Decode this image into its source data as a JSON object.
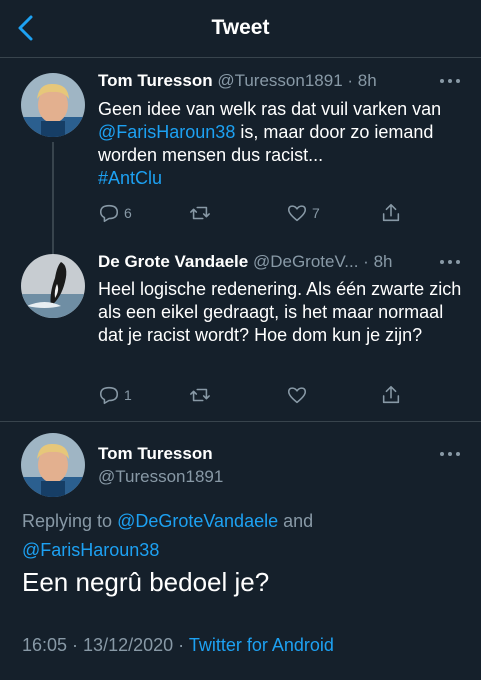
{
  "header": {
    "title": "Tweet"
  },
  "tweets": [
    {
      "name": "Tom Turesson",
      "handle": "@Turesson1891",
      "dot": "·",
      "time": "8h",
      "text_before": "Geen idee van welk ras dat vuil varken van ",
      "mention": "@FarisHaroun38",
      "text_after": " is, maar door zo iemand worden mensen dus racist...",
      "hashtag": "#AntClu",
      "reply_count": "6",
      "retweet_count": "",
      "like_count": "7"
    },
    {
      "name": "De Grote Vandaele",
      "handle": "@DeGroteV...",
      "dot": "·",
      "time": "8h",
      "text": "Heel logische redenering. Als één zwarte zich als een eikel gedraagt, is het maar normaal dat je racist wordt? Hoe dom kun je zijn?",
      "reply_count": "1",
      "retweet_count": "",
      "like_count": ""
    }
  ],
  "focused": {
    "name": "Tom Turesson",
    "handle": "@Turesson1891",
    "replying_prefix": "Replying to ",
    "reply_mention_1": "@DeGroteVandaele",
    "reply_and": " and",
    "reply_mention_2": "@FarisHaroun38",
    "text": "Een negrû bedoel je?",
    "time": "16:05",
    "sep": " · ",
    "date": "13/12/2020",
    "sep2": " · ",
    "source": "Twitter for Android"
  },
  "colors": {
    "background": "#15202b",
    "accent": "#1da1f2",
    "secondary_text": "#8899a6",
    "divider": "#38444d"
  },
  "icons": [
    "back-arrow-icon",
    "more-icon",
    "reply-icon",
    "retweet-icon",
    "like-icon",
    "share-icon"
  ]
}
